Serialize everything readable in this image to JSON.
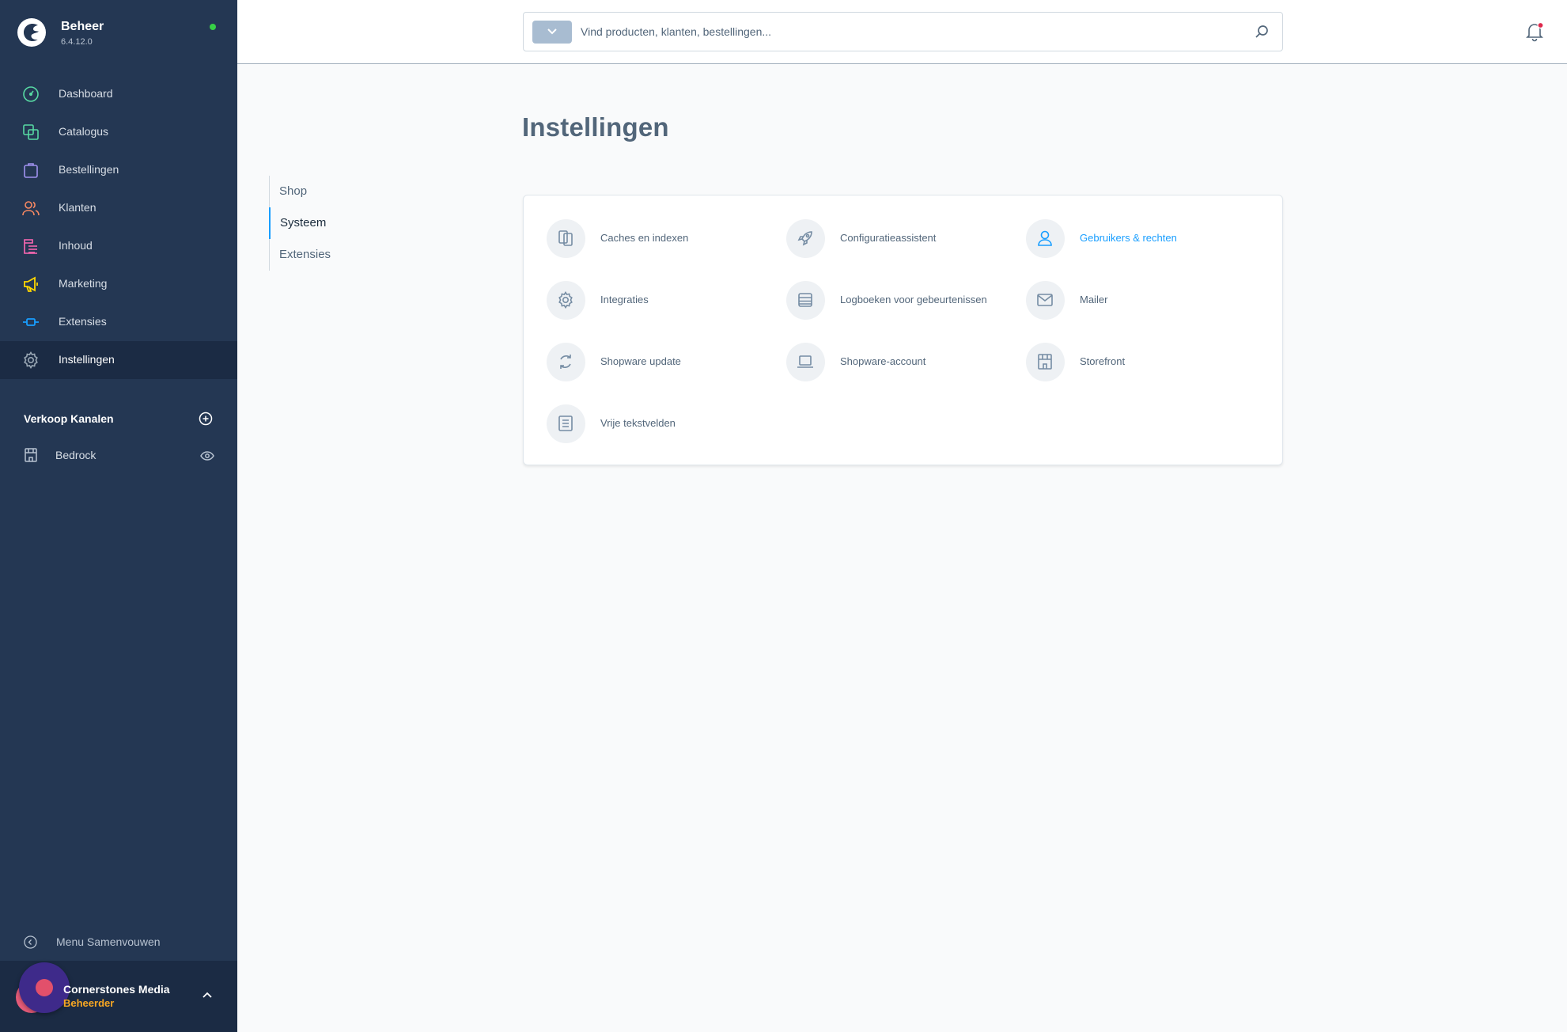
{
  "app": {
    "title": "Beheer",
    "version": "6.4.12.0",
    "colors": {
      "sidebar": "#243753",
      "accent": "#189eff",
      "status_online": "#37d046",
      "role": "#f6a623"
    }
  },
  "sidebar": {
    "items": [
      {
        "label": "Dashboard",
        "icon": "dashboard-icon",
        "color": "#57d9a3"
      },
      {
        "label": "Catalogus",
        "icon": "catalog-icon",
        "color": "#57d9a3"
      },
      {
        "label": "Bestellingen",
        "icon": "orders-icon",
        "color": "#a092f0"
      },
      {
        "label": "Klanten",
        "icon": "customers-icon",
        "color": "#f88962"
      },
      {
        "label": "Inhoud",
        "icon": "content-icon",
        "color": "#ff68b4"
      },
      {
        "label": "Marketing",
        "icon": "marketing-icon",
        "color": "#ffd700"
      },
      {
        "label": "Extensies",
        "icon": "extensions-icon",
        "color": "#189eff"
      },
      {
        "label": "Instellingen",
        "icon": "settings-icon",
        "color": "#9aa8b5",
        "active": true
      }
    ],
    "channels": {
      "heading": "Verkoop Kanalen",
      "items": [
        {
          "label": "Bedrock"
        }
      ]
    },
    "collapse_label": "Menu Samenvouwen",
    "user": {
      "name": "Cornerstones Media",
      "role": "Beheerder"
    }
  },
  "header": {
    "search": {
      "placeholder": "Vind producten, klanten, bestellingen..."
    }
  },
  "main": {
    "title": "Instellingen",
    "tabs": [
      {
        "label": "Shop"
      },
      {
        "label": "Systeem",
        "active": true
      },
      {
        "label": "Extensies"
      }
    ],
    "tiles": [
      {
        "label": "Caches en indexen",
        "icon": "cache-icon"
      },
      {
        "label": "Configuratieassistent",
        "icon": "rocket-icon"
      },
      {
        "label": "Gebruikers & rechten",
        "icon": "user-icon",
        "active": true
      },
      {
        "label": "Integraties",
        "icon": "gear-icon"
      },
      {
        "label": "Logboeken voor gebeurtenissen",
        "icon": "log-icon"
      },
      {
        "label": "Mailer",
        "icon": "mail-icon"
      },
      {
        "label": "Shopware update",
        "icon": "refresh-icon"
      },
      {
        "label": "Shopware-account",
        "icon": "laptop-icon"
      },
      {
        "label": "Storefront",
        "icon": "storefront-icon"
      },
      {
        "label": "Vrije tekstvelden",
        "icon": "text-fields-icon"
      }
    ]
  }
}
